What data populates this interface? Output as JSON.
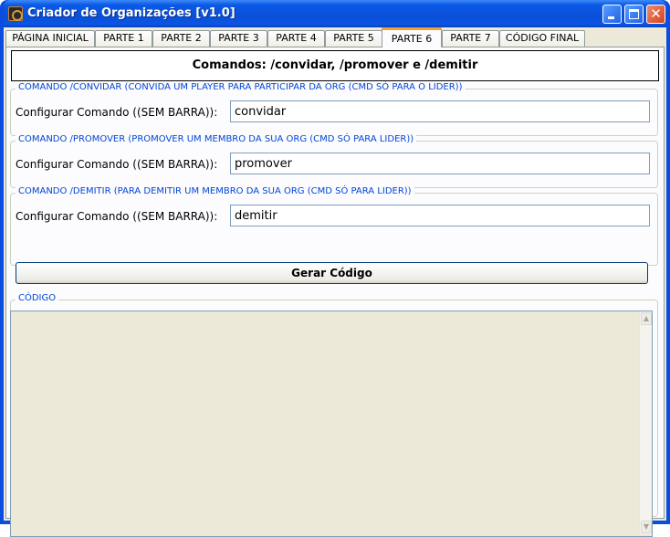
{
  "window": {
    "title": "Criador de Organizações [v1.0]"
  },
  "tabs": [
    {
      "label": "PÁGINA INICIAL",
      "active": false
    },
    {
      "label": "PARTE 1",
      "active": false
    },
    {
      "label": "PARTE 2",
      "active": false
    },
    {
      "label": "PARTE 3",
      "active": false
    },
    {
      "label": "PARTE 4",
      "active": false
    },
    {
      "label": "PARTE 5",
      "active": false
    },
    {
      "label": "PARTE 6",
      "active": true
    },
    {
      "label": "PARTE 7",
      "active": false
    },
    {
      "label": "CÓDIGO FINAL",
      "active": false
    }
  ],
  "header": {
    "text": "Comandos: /convidar, /promover e /demitir"
  },
  "groups": {
    "convidar": {
      "legend": "COMANDO  /CONVIDAR  (CONVIDA UM PLAYER PARA PARTICIPAR DA ORG (CMD SÓ PARA O LIDER))",
      "label": "Configurar Comando ((SEM BARRA)):",
      "value": "convidar"
    },
    "promover": {
      "legend": "COMANDO  /PROMOVER  (PROMOVER UM MEMBRO DA SUA ORG (CMD SÓ PARA LIDER))",
      "label": "Configurar Comando ((SEM BARRA)):",
      "value": "promover"
    },
    "demitir": {
      "legend": "COMANDO  /DEMITIR  (PARA DEMITIR UM MEMBRO DA SUA ORG (CMD SÓ PARA LIDER))",
      "label": "Configurar Comando ((SEM BARRA)):",
      "value": "demitir"
    }
  },
  "generate_button": {
    "label": "Gerar Código"
  },
  "code": {
    "legend": "CÓDIGO",
    "value": ""
  },
  "colors": {
    "title_bar": "#0a4fd6",
    "active_tab_accent": "#f0a030",
    "legend_text": "#0046d5",
    "window_background": "#ece9d8"
  },
  "icons": {
    "app": "app-icon",
    "minimize": "minimize-icon",
    "maximize": "maximize-icon",
    "close": "close-icon",
    "scroll_up": "scroll-up-arrow-icon",
    "scroll_down": "scroll-down-arrow-icon"
  }
}
